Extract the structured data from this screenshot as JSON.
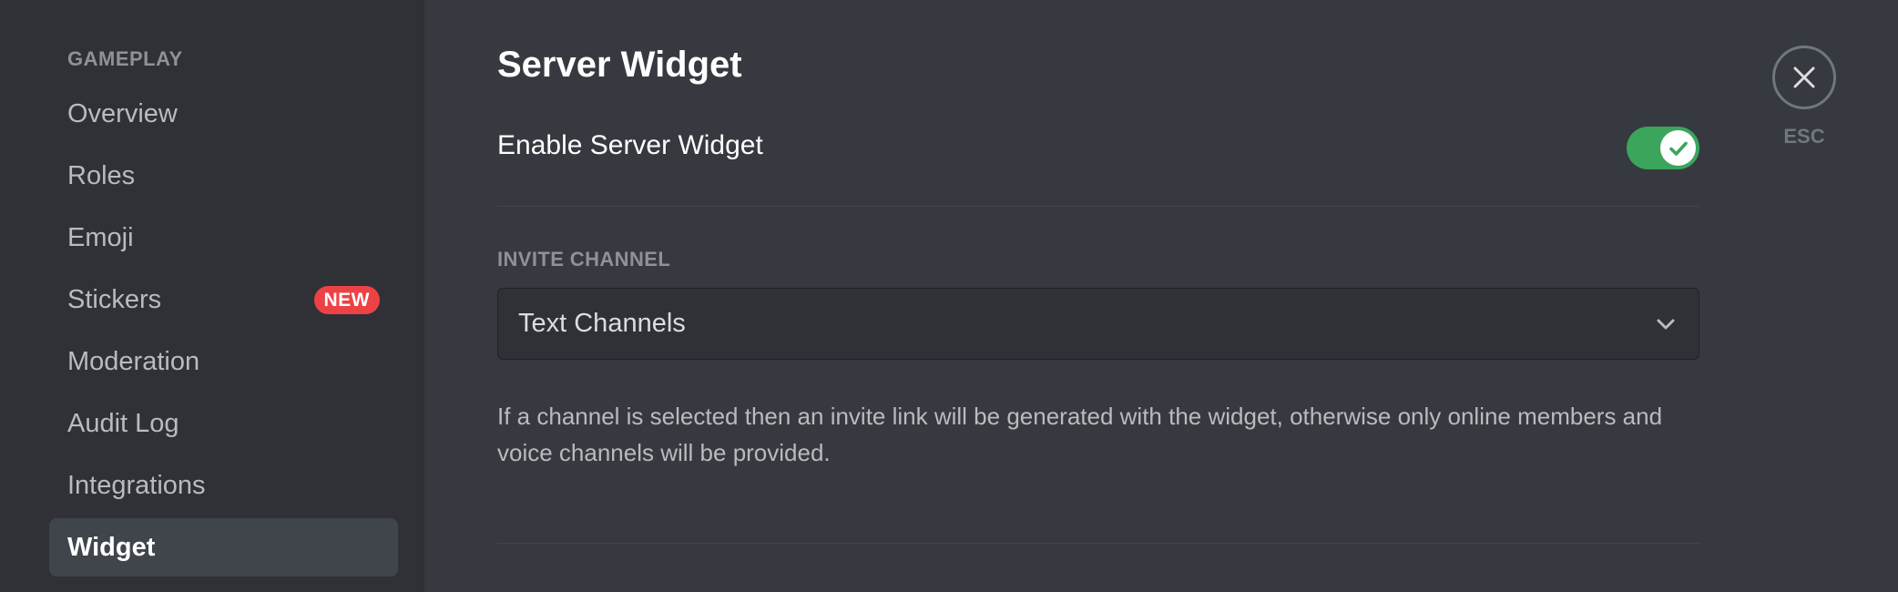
{
  "sidebar": {
    "header": "GAMEPLAY",
    "items": [
      {
        "label": "Overview"
      },
      {
        "label": "Roles"
      },
      {
        "label": "Emoji"
      },
      {
        "label": "Stickers",
        "badge": "NEW"
      },
      {
        "label": "Moderation"
      },
      {
        "label": "Audit Log"
      },
      {
        "label": "Integrations"
      },
      {
        "label": "Widget",
        "selected": true
      }
    ]
  },
  "main": {
    "title": "Server Widget",
    "enable_toggle": {
      "label": "Enable Server Widget",
      "checked": true
    },
    "invite_channel": {
      "label": "INVITE CHANNEL",
      "selected_value": "Text Channels"
    },
    "help_text": "If a channel is selected then an invite link will be generated with the widget, otherwise only online members and voice channels will be provided."
  },
  "close": {
    "label": "ESC",
    "icon": "close-icon"
  },
  "colors": {
    "sidebar_bg": "#2f3136",
    "content_bg": "#36393f",
    "toggle_on": "#3ba55c",
    "badge_red": "#ed4245"
  }
}
